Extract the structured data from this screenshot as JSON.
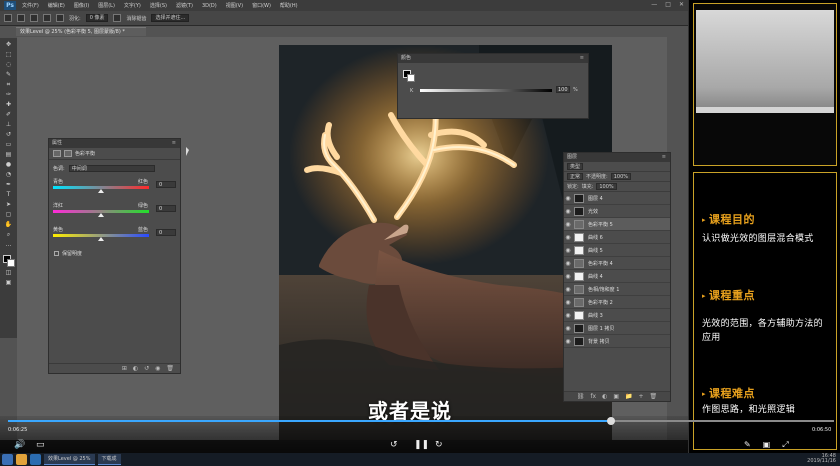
{
  "menubar": {
    "logo": "Ps",
    "items": [
      "文件(F)",
      "编辑(E)",
      "图像(I)",
      "图层(L)",
      "文字(Y)",
      "选择(S)",
      "滤镜(T)",
      "3D(D)",
      "视图(V)",
      "窗口(W)",
      "帮助(H)"
    ],
    "window_controls": [
      "—",
      "□",
      "✕"
    ]
  },
  "options": {
    "feather_label": "羽化:",
    "feather_value": "0 像素",
    "antialias_label": "消除锯齿",
    "select_mask": "选择并遮住..."
  },
  "doc_tab": "效果Level @ 25% (色彩平衡 5, 图层蒙版/8) *",
  "properties": {
    "title": "属性",
    "subtitle": "色彩平衡",
    "tone_label": "色调:",
    "tone_value": "中间调",
    "sliders": [
      {
        "left": "青色",
        "right": "红色",
        "value": "0",
        "knob": 0.5,
        "gradient": "linear-gradient(to right,#00e5ff,#ff2a2a)"
      },
      {
        "left": "洋红",
        "right": "绿色",
        "value": "0",
        "knob": 0.5,
        "gradient": "linear-gradient(to right,#ff2ad9,#22e02a)"
      },
      {
        "left": "黄色",
        "right": "蓝色",
        "value": "0",
        "knob": 0.5,
        "gradient": "linear-gradient(to right,#ffee00,#2a4bff)"
      }
    ],
    "preserve_label": "保留明度",
    "footer_icons": [
      "⊞",
      "◐",
      "↺",
      "◉",
      "🗑"
    ]
  },
  "color_panel": {
    "title": "颜色",
    "k_label": "K",
    "value": "100",
    "unit": "%"
  },
  "layers": {
    "title": "图层",
    "kind": "类型",
    "blend": "正常",
    "opacity_label": "不透明度:",
    "opacity": "100%",
    "lock_label": "锁定:",
    "fill_label": "填充:",
    "fill": "100%",
    "items": [
      {
        "name": "图层 4",
        "thumb": "photo",
        "sel": false
      },
      {
        "name": "光效",
        "thumb": "group",
        "sel": false
      },
      {
        "name": "色彩平衡 5",
        "thumb": "adj",
        "sel": true
      },
      {
        "name": "曲线 6",
        "thumb": "mask",
        "sel": false
      },
      {
        "name": "曲线 5",
        "thumb": "mask",
        "sel": false
      },
      {
        "name": "色彩平衡 4",
        "thumb": "adj",
        "sel": false
      },
      {
        "name": "曲线 4",
        "thumb": "mask",
        "sel": false
      },
      {
        "name": "色相/饱和度 1",
        "thumb": "adj",
        "sel": false
      },
      {
        "name": "色彩平衡 2",
        "thumb": "adj",
        "sel": false
      },
      {
        "name": "曲线 3",
        "thumb": "mask",
        "sel": false
      },
      {
        "name": "图层 1 拷贝",
        "thumb": "photo",
        "sel": false
      },
      {
        "name": "背景 拷贝",
        "thumb": "photo",
        "sel": false
      }
    ],
    "footer_icons": [
      "⛓",
      "fx",
      "◐",
      "▣",
      "📁",
      "+",
      "🗑"
    ]
  },
  "video": {
    "subtitle": "或者是说",
    "current": "0:06:25",
    "total": "0:06:50",
    "progress": 0.73
  },
  "side": {
    "sections": [
      {
        "heading": "课程目的",
        "body": "认识做光效的图层混合模式"
      },
      {
        "heading": "课程重点",
        "body": "光效的范围，各方辅助方法的应用"
      },
      {
        "heading": "课程难点",
        "body": "作图思路，和光照逻辑"
      }
    ]
  },
  "taskbar": {
    "window_title": "效果Level @ 25%",
    "folder_title": "下载成",
    "clock": "16:48",
    "date": "2019/11/16"
  }
}
